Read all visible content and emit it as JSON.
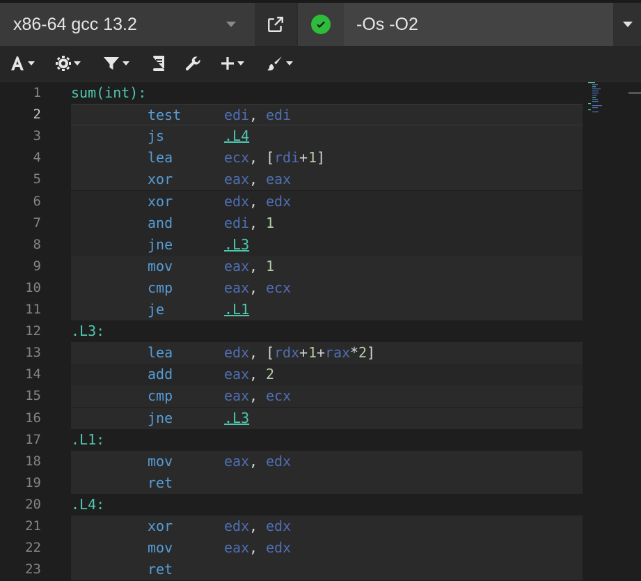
{
  "header": {
    "compiler": "x86-64 gcc 13.2",
    "options": "-Os -O2",
    "status": "compiled-ok"
  },
  "toolbar": {
    "items": [
      "font-icon",
      "gear-icon",
      "filter-icon",
      "book-icon",
      "wrench-icon",
      "plus-icon",
      "brush-icon"
    ]
  },
  "editor": {
    "active_line": 2,
    "lines": [
      {
        "n": "1",
        "type": "label",
        "label": "sum(int):"
      },
      {
        "n": "2",
        "op": "test",
        "args": [
          [
            "reg",
            "edi"
          ],
          [
            "punc",
            ", "
          ],
          [
            "reg",
            "edi"
          ]
        ]
      },
      {
        "n": "3",
        "op": "js",
        "args": [
          [
            "link",
            ".L4"
          ]
        ]
      },
      {
        "n": "4",
        "op": "lea",
        "args": [
          [
            "reg",
            "ecx"
          ],
          [
            "punc",
            ", ["
          ],
          [
            "reg",
            "rdi"
          ],
          [
            "punc",
            "+"
          ],
          [
            "num",
            "1"
          ],
          [
            "punc",
            "]"
          ]
        ]
      },
      {
        "n": "5",
        "op": "xor",
        "args": [
          [
            "reg",
            "eax"
          ],
          [
            "punc",
            ", "
          ],
          [
            "reg",
            "eax"
          ]
        ]
      },
      {
        "n": "6",
        "op": "xor",
        "args": [
          [
            "reg",
            "edx"
          ],
          [
            "punc",
            ", "
          ],
          [
            "reg",
            "edx"
          ]
        ]
      },
      {
        "n": "7",
        "op": "and",
        "args": [
          [
            "reg",
            "edi"
          ],
          [
            "punc",
            ", "
          ],
          [
            "num",
            "1"
          ]
        ]
      },
      {
        "n": "8",
        "op": "jne",
        "args": [
          [
            "link",
            ".L3"
          ]
        ]
      },
      {
        "n": "9",
        "op": "mov",
        "args": [
          [
            "reg",
            "eax"
          ],
          [
            "punc",
            ", "
          ],
          [
            "num",
            "1"
          ]
        ]
      },
      {
        "n": "10",
        "op": "cmp",
        "args": [
          [
            "reg",
            "eax"
          ],
          [
            "punc",
            ", "
          ],
          [
            "reg",
            "ecx"
          ]
        ]
      },
      {
        "n": "11",
        "op": "je",
        "args": [
          [
            "link",
            ".L1"
          ]
        ]
      },
      {
        "n": "12",
        "type": "label",
        "label": ".L3:"
      },
      {
        "n": "13",
        "op": "lea",
        "args": [
          [
            "reg",
            "edx"
          ],
          [
            "punc",
            ", ["
          ],
          [
            "reg",
            "rdx"
          ],
          [
            "punc",
            "+"
          ],
          [
            "num",
            "1"
          ],
          [
            "punc",
            "+"
          ],
          [
            "reg",
            "rax"
          ],
          [
            "punc",
            "*"
          ],
          [
            "num",
            "2"
          ],
          [
            "punc",
            "]"
          ]
        ]
      },
      {
        "n": "14",
        "op": "add",
        "args": [
          [
            "reg",
            "eax"
          ],
          [
            "punc",
            ", "
          ],
          [
            "num",
            "2"
          ]
        ]
      },
      {
        "n": "15",
        "op": "cmp",
        "args": [
          [
            "reg",
            "eax"
          ],
          [
            "punc",
            ", "
          ],
          [
            "reg",
            "ecx"
          ]
        ]
      },
      {
        "n": "16",
        "op": "jne",
        "args": [
          [
            "link",
            ".L3"
          ]
        ]
      },
      {
        "n": "17",
        "type": "label",
        "label": ".L1:"
      },
      {
        "n": "18",
        "op": "mov",
        "args": [
          [
            "reg",
            "eax"
          ],
          [
            "punc",
            ", "
          ],
          [
            "reg",
            "edx"
          ]
        ]
      },
      {
        "n": "19",
        "op": "ret",
        "args": []
      },
      {
        "n": "20",
        "type": "label",
        "label": ".L4:"
      },
      {
        "n": "21",
        "op": "xor",
        "args": [
          [
            "reg",
            "edx"
          ],
          [
            "punc",
            ", "
          ],
          [
            "reg",
            "edx"
          ]
        ]
      },
      {
        "n": "22",
        "op": "mov",
        "args": [
          [
            "reg",
            "eax"
          ],
          [
            "punc",
            ", "
          ],
          [
            "reg",
            "edx"
          ]
        ]
      },
      {
        "n": "23",
        "op": "ret",
        "args": []
      }
    ]
  }
}
